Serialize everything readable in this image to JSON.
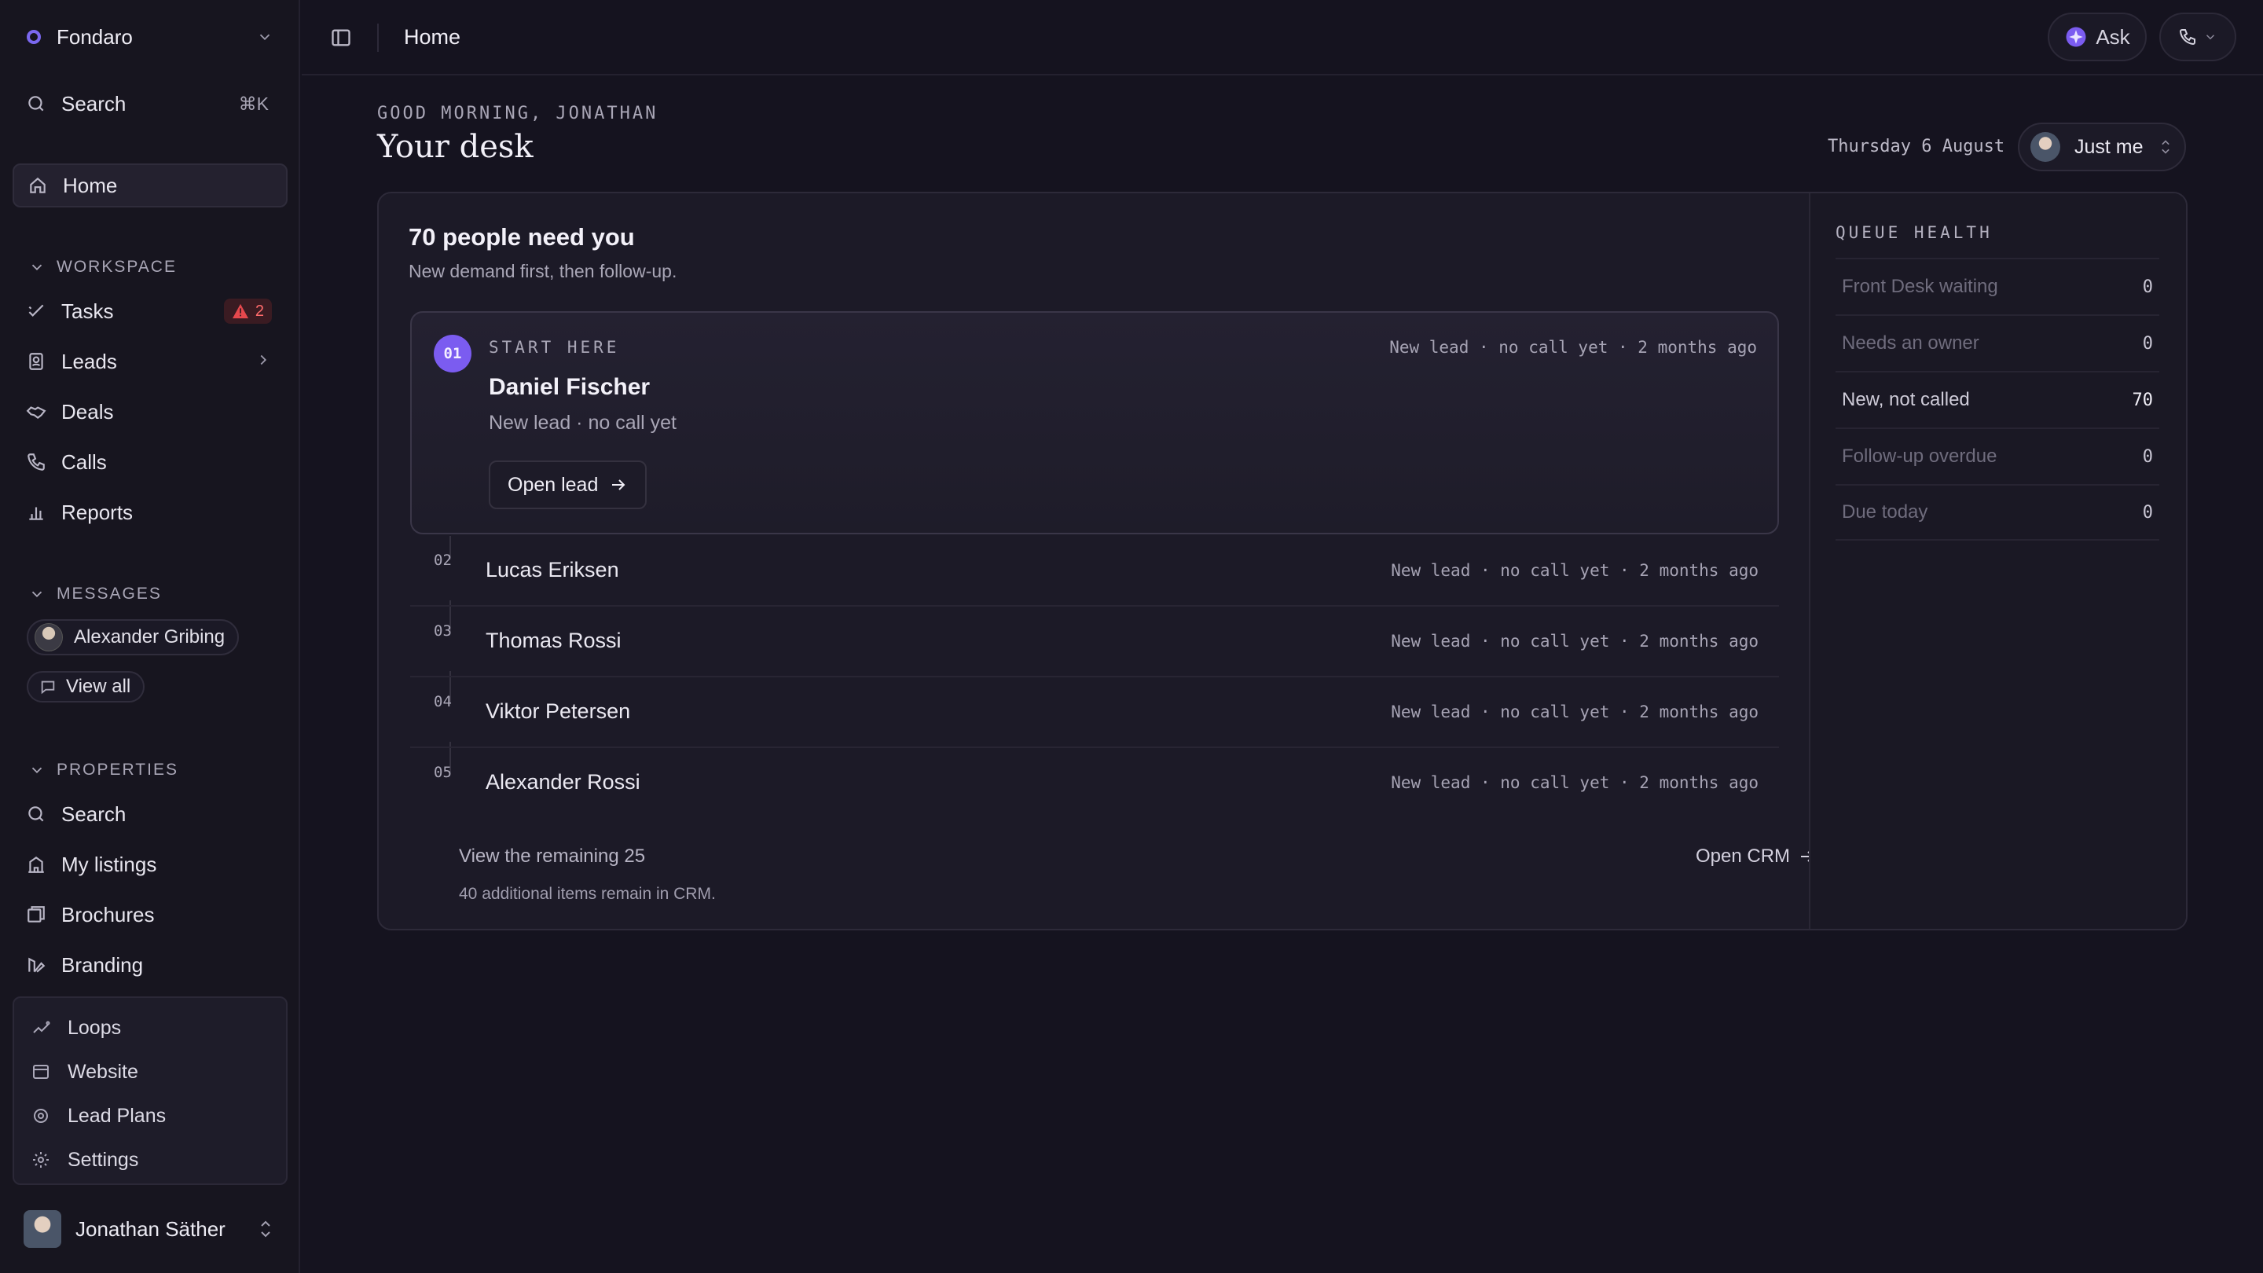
{
  "sidebar": {
    "org_name": "Fondaro",
    "search_label": "Search",
    "search_shortcut": "⌘K",
    "home_label": "Home",
    "workspace_title": "WORKSPACE",
    "workspace_items": [
      {
        "label": "Tasks",
        "badge": "2"
      },
      {
        "label": "Leads"
      },
      {
        "label": "Deals"
      },
      {
        "label": "Calls"
      },
      {
        "label": "Reports"
      }
    ],
    "messages_title": "MESSAGES",
    "message_contact": "Alexander Gribing",
    "view_all": "View all",
    "properties_title": "PROPERTIES",
    "property_items": [
      {
        "label": "Search"
      },
      {
        "label": "My listings"
      },
      {
        "label": "Brochures"
      },
      {
        "label": "Branding"
      }
    ],
    "sub_items": [
      {
        "label": "Loops"
      },
      {
        "label": "Website"
      },
      {
        "label": "Lead Plans"
      },
      {
        "label": "Settings"
      }
    ],
    "user_name": "Jonathan Säther"
  },
  "topbar": {
    "title": "Home",
    "ask_label": "Ask"
  },
  "main": {
    "greeting": "GOOD MORNING, JONATHAN",
    "title": "Your desk",
    "date": "Thursday 6 August",
    "scope_label": "Just me",
    "card": {
      "headline": "70 people need you",
      "subline": "New demand first, then follow-up.",
      "hero": {
        "rank": "01",
        "eyebrow": "START HERE",
        "meta": "New lead · no call yet · 2 months ago",
        "name": "Daniel Fischer",
        "detail": "New lead · no call yet",
        "button": "Open lead"
      },
      "rows": [
        {
          "rank": "02",
          "name": "Lucas Eriksen",
          "meta": "New lead · no call yet · 2 months ago"
        },
        {
          "rank": "03",
          "name": "Thomas Rossi",
          "meta": "New lead · no call yet · 2 months ago"
        },
        {
          "rank": "04",
          "name": "Viktor Petersen",
          "meta": "New lead · no call yet · 2 months ago"
        },
        {
          "rank": "05",
          "name": "Alexander Rossi",
          "meta": "New lead · no call yet · 2 months ago"
        }
      ],
      "remaining_label": "View the remaining 25",
      "remaining_note": "40 additional items remain in CRM.",
      "open_crm": "Open CRM"
    },
    "queue_health": {
      "title": "QUEUE HEALTH",
      "items": [
        {
          "label": "Front Desk waiting",
          "value": "0"
        },
        {
          "label": "Needs an owner",
          "value": "0"
        },
        {
          "label": "New, not called",
          "value": "70"
        },
        {
          "label": "Follow-up overdue",
          "value": "0"
        },
        {
          "label": "Due today",
          "value": "0"
        }
      ]
    }
  },
  "colors": {
    "accent": "#7b5cf0",
    "alert": "#e5484d",
    "background": "#15131f"
  }
}
